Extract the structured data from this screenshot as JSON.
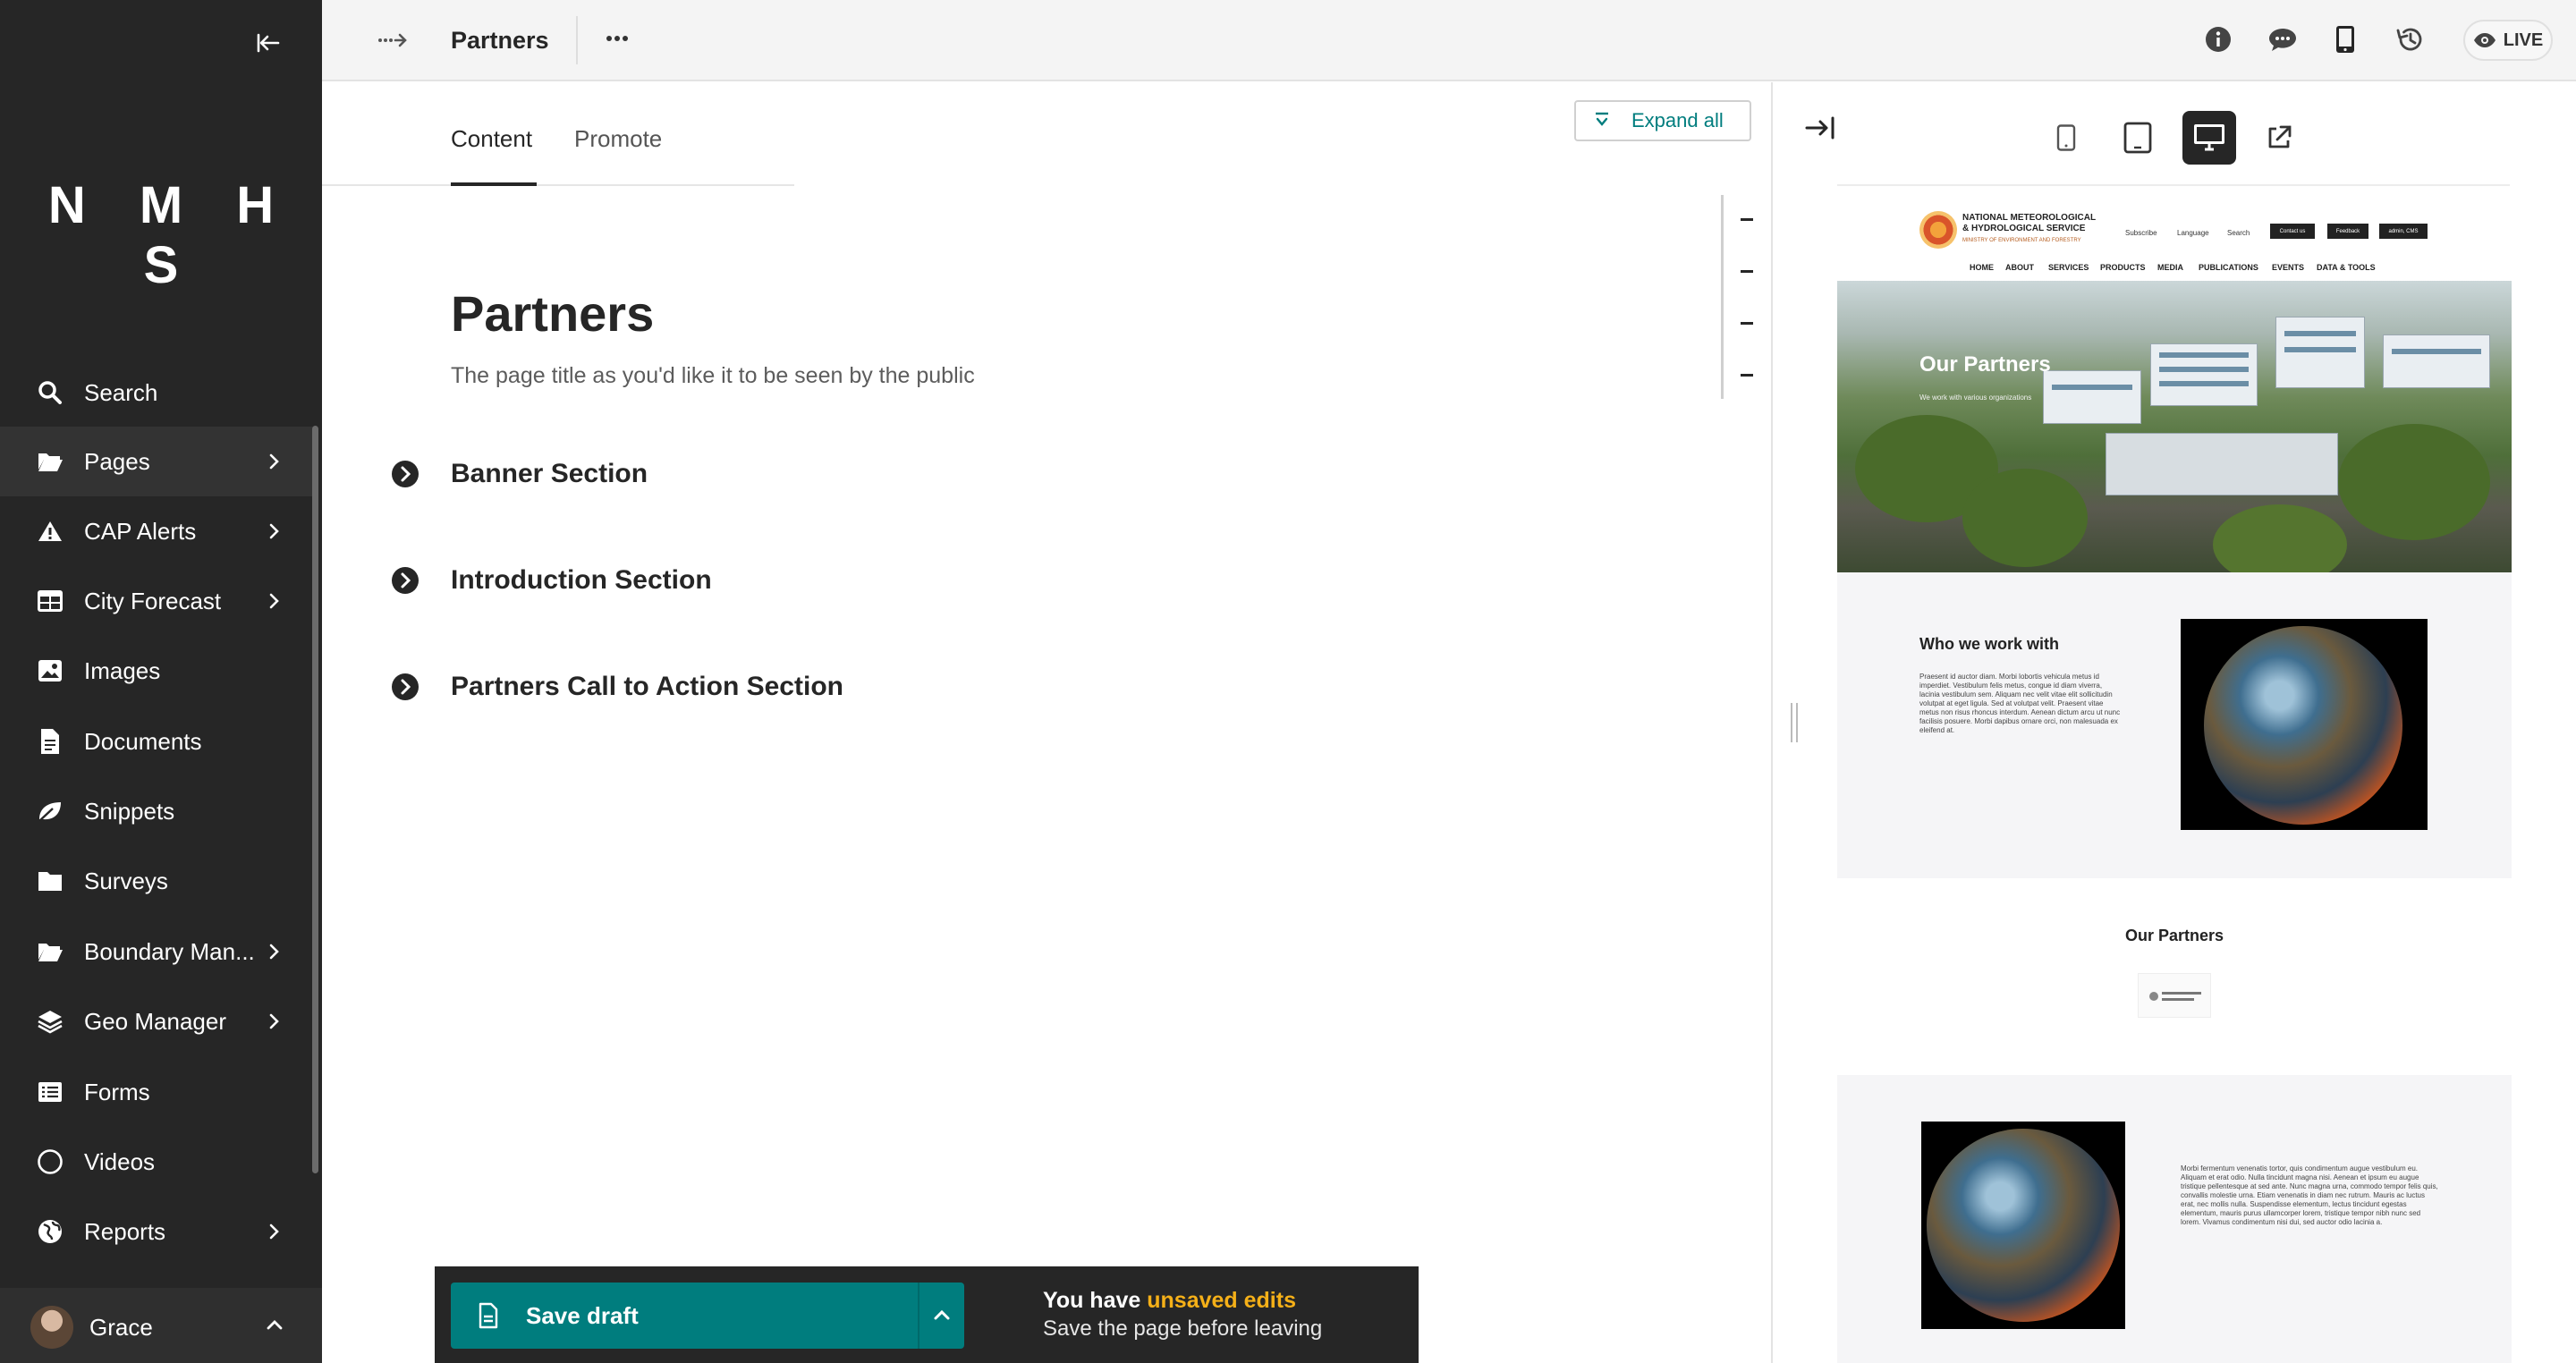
{
  "sidebar": {
    "logo": "N M H S",
    "items": [
      {
        "label": "Search",
        "icon": "search-icon"
      },
      {
        "label": "Pages",
        "icon": "folder-open-icon"
      },
      {
        "label": "CAP Alerts",
        "icon": "warning-icon"
      },
      {
        "label": "City Forecast",
        "icon": "table-icon"
      },
      {
        "label": "Images",
        "icon": "image-icon"
      },
      {
        "label": "Documents",
        "icon": "document-icon"
      },
      {
        "label": "Snippets",
        "icon": "snippet-icon"
      },
      {
        "label": "Surveys",
        "icon": "folder-icon"
      },
      {
        "label": "Boundary Man...",
        "icon": "folder-open-icon"
      },
      {
        "label": "Geo Manager",
        "icon": "layers-icon"
      },
      {
        "label": "Forms",
        "icon": "list-icon"
      },
      {
        "label": "Videos",
        "icon": "circle-icon"
      },
      {
        "label": "Reports",
        "icon": "globe-icon"
      }
    ],
    "user": {
      "name": "Grace"
    }
  },
  "header": {
    "title": "Partners",
    "live_label": "LIVE"
  },
  "editor": {
    "tabs": [
      {
        "label": "Content"
      },
      {
        "label": "Promote"
      }
    ],
    "expand_all": "Expand all",
    "page_title": "Partners",
    "page_title_help": "The page title as you'd like it to be seen by the public",
    "sections": [
      {
        "label": "Banner Section"
      },
      {
        "label": "Introduction Section"
      },
      {
        "label": "Partners Call to Action Section"
      }
    ]
  },
  "footer": {
    "save_label": "Save draft",
    "unsaved_prefix": "You have ",
    "unsaved_highlight": "unsaved edits",
    "unsaved_sub": "Save the page before leaving"
  },
  "preview": {
    "site": {
      "org_name": "NATIONAL METEOROLOGICAL & HYDROLOGICAL SERVICE",
      "org_sub": "MINISTRY OF ENVIRONMENT AND FORESTRY",
      "util": [
        "Subscribe",
        "Language",
        "Search"
      ],
      "buttons": [
        "Contact us",
        "Feedback",
        "admin, CMS"
      ],
      "nav": [
        "HOME",
        "ABOUT",
        "SERVICES",
        "PRODUCTS",
        "MEDIA",
        "PUBLICATIONS",
        "EVENTS",
        "DATA & TOOLS"
      ],
      "hero_title": "Our Partners",
      "hero_sub": "We work with various organizations",
      "who_title": "Who we work with",
      "who_text": "Praesent id auctor diam. Morbi lobortis vehicula metus id imperdiet. Vestibulum felis metus, congue id diam viverra, lacinia vestibulum sem. Aliquam nec velit vitae elit sollicitudin volutpat at eget ligula. Sed at volutpat velit. Praesent vitae metus non risus rhoncus interdum. Aenean dictum arcu ut nunc facilisis posuere. Morbi dapibus ornare orci, non malesuada ex eleifend at.",
      "partners_title": "Our Partners",
      "cta_text": "Morbi fermentum venenatis tortor, quis condimentum augue vestibulum eu. Aliquam et erat odio. Nulla tincidunt magna nisi. Aenean et ipsum eu augue tristique pellentesque at sed ante. Nunc magna urna, commodo tempor felis quis, convallis molestie urna. Etiam venenatis in diam nec rutrum. Mauris ac luctus erat, nec mollis nulla. Suspendisse elementum, lectus tincidunt egestas elementum, mauris purus ullamcorper lorem, tristique tempor nibh nunc sed lorem. Vivamus condimentum nisi dui, sed auctor odio lacinia a."
    }
  },
  "colors": {
    "sidebar_bg": "#262626",
    "accent": "#007d7e",
    "unsaved_highlight": "#f5b018"
  }
}
